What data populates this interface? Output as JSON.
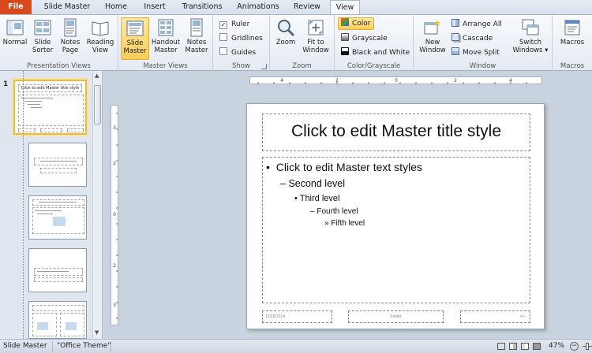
{
  "tabs": [
    "File",
    "Slide Master",
    "Home",
    "Insert",
    "Transitions",
    "Animations",
    "Review",
    "View"
  ],
  "ribbon": {
    "presentation_views": {
      "label": "Presentation Views",
      "buttons": [
        {
          "label": "Normal",
          "icon": "normal-view-icon"
        },
        {
          "label": "Slide Sorter",
          "icon": "slide-sorter-icon"
        },
        {
          "label": "Notes Page",
          "icon": "notes-page-icon"
        },
        {
          "label": "Reading View",
          "icon": "reading-view-icon"
        }
      ]
    },
    "master_views": {
      "label": "Master Views",
      "buttons": [
        {
          "label": "Slide Master",
          "icon": "slide-master-icon",
          "active": true
        },
        {
          "label": "Handout Master",
          "icon": "handout-master-icon"
        },
        {
          "label": "Notes Master",
          "icon": "notes-master-icon"
        }
      ]
    },
    "show": {
      "label": "Show",
      "items": [
        {
          "label": "Ruler",
          "checked": true
        },
        {
          "label": "Gridlines",
          "checked": false
        },
        {
          "label": "Guides",
          "checked": false
        }
      ]
    },
    "zoom": {
      "label": "Zoom",
      "buttons": [
        {
          "label": "Zoom",
          "icon": "magnifier-icon"
        },
        {
          "label": "Fit to Window",
          "icon": "fit-window-icon"
        }
      ]
    },
    "color": {
      "label": "Color/Grayscale",
      "items": [
        {
          "label": "Color",
          "swatch": "#e8583a",
          "active": true
        },
        {
          "label": "Grayscale",
          "swatch": "#888888"
        },
        {
          "label": "Black and White",
          "swatch": "#111111"
        }
      ]
    },
    "window": {
      "label": "Window",
      "new_window": "New Window",
      "items": [
        "Arrange All",
        "Cascade",
        "Move Split"
      ],
      "switch": "Switch Windows"
    },
    "macros": {
      "label": "Macros",
      "button": "Macros"
    }
  },
  "thumbnails": {
    "first_number": "1",
    "first_title": "Click to edit Master title style"
  },
  "slide": {
    "title": "Click to edit Master title style",
    "levels": [
      "Click to edit Master text styles",
      "Second level",
      "Third level",
      "Fourth level",
      "Fifth level"
    ],
    "bullets": [
      "•",
      "–",
      "•",
      "–",
      "»"
    ],
    "date": "12/16/2014",
    "footer": "Footer",
    "slide_num": "‹#›"
  },
  "status": {
    "view": "Slide Master",
    "theme": "\"Office Theme\"",
    "zoom": "47%",
    "zoom_fraction": 0.47
  },
  "colors": {
    "file_tab": "#d8491e",
    "active_highlight": "#f9cd5a",
    "selection_border": "#f0b83c"
  }
}
